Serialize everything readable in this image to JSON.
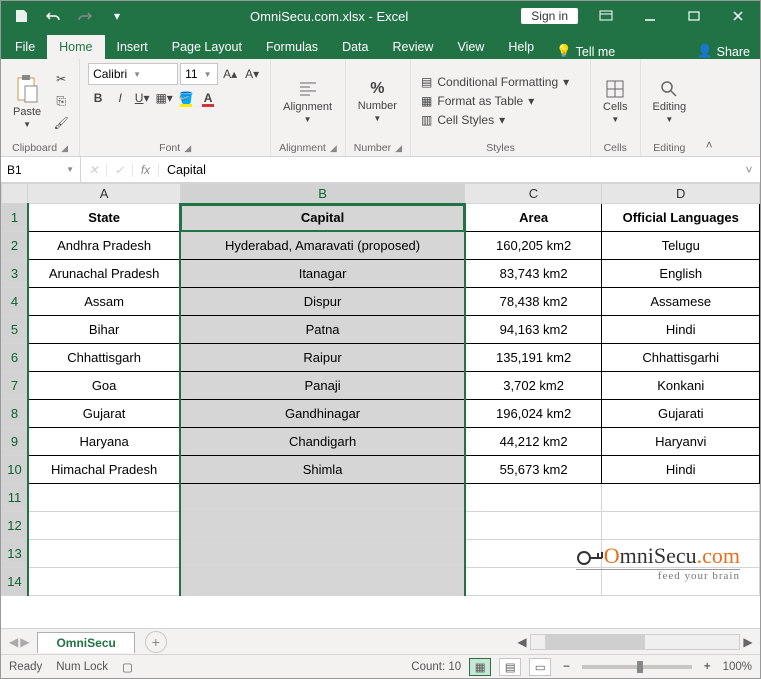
{
  "title": "OmniSecu.com.xlsx - Excel",
  "sign_in": "Sign in",
  "tabs": {
    "file": "File",
    "home": "Home",
    "insert": "Insert",
    "page_layout": "Page Layout",
    "formulas": "Formulas",
    "data": "Data",
    "review": "Review",
    "view": "View",
    "help": "Help",
    "tellme": "Tell me",
    "share": "Share"
  },
  "ribbon": {
    "clipboard": {
      "paste": "Paste",
      "label": "Clipboard"
    },
    "font": {
      "name": "Calibri",
      "size": "11",
      "label": "Font"
    },
    "alignment": {
      "btn": "Alignment",
      "label": "Alignment"
    },
    "number": {
      "btn": "Number",
      "label": "Number"
    },
    "styles": {
      "cf": "Conditional Formatting",
      "tbl": "Format as Table",
      "cs": "Cell Styles",
      "label": "Styles"
    },
    "cells": {
      "btn": "Cells",
      "label": "Cells"
    },
    "editing": {
      "btn": "Editing",
      "label": "Editing"
    }
  },
  "namebox": "B1",
  "formula": "Capital",
  "columns": [
    "A",
    "B",
    "C",
    "D"
  ],
  "col_widths": [
    "150px",
    "280px",
    "135px",
    "155px"
  ],
  "selected_col": 1,
  "headers": [
    "State",
    "Capital",
    "Area",
    "Official Languages"
  ],
  "rows": [
    [
      "Andhra Pradesh",
      "Hyderabad, Amaravati (proposed)",
      "160,205 km2",
      "Telugu"
    ],
    [
      "Arunachal Pradesh",
      "Itanagar",
      "83,743 km2",
      "English"
    ],
    [
      "Assam",
      "Dispur",
      "78,438 km2",
      "Assamese"
    ],
    [
      "Bihar",
      "Patna",
      "94,163 km2",
      "Hindi"
    ],
    [
      "Chhattisgarh",
      "Raipur",
      "135,191 km2",
      "Chhattisgarhi"
    ],
    [
      "Goa",
      "Panaji",
      "3,702 km2",
      "Konkani"
    ],
    [
      "Gujarat",
      "Gandhinagar",
      "196,024 km2",
      "Gujarati"
    ],
    [
      "Haryana",
      "Chandigarh",
      "44,212 km2",
      "Haryanvi"
    ],
    [
      "Himachal Pradesh",
      "Shimla",
      "55,673 km2",
      "Hindi"
    ]
  ],
  "empty_rows": [
    11,
    12,
    13,
    14
  ],
  "sheet_tab": "OmniSecu",
  "status": {
    "ready": "Ready",
    "numlock": "Num Lock",
    "count": "Count: 10",
    "zoom": "100%"
  },
  "watermark": {
    "brand_pre": "mniSecu",
    "brand_post": ".com",
    "tag": "feed your brain"
  }
}
